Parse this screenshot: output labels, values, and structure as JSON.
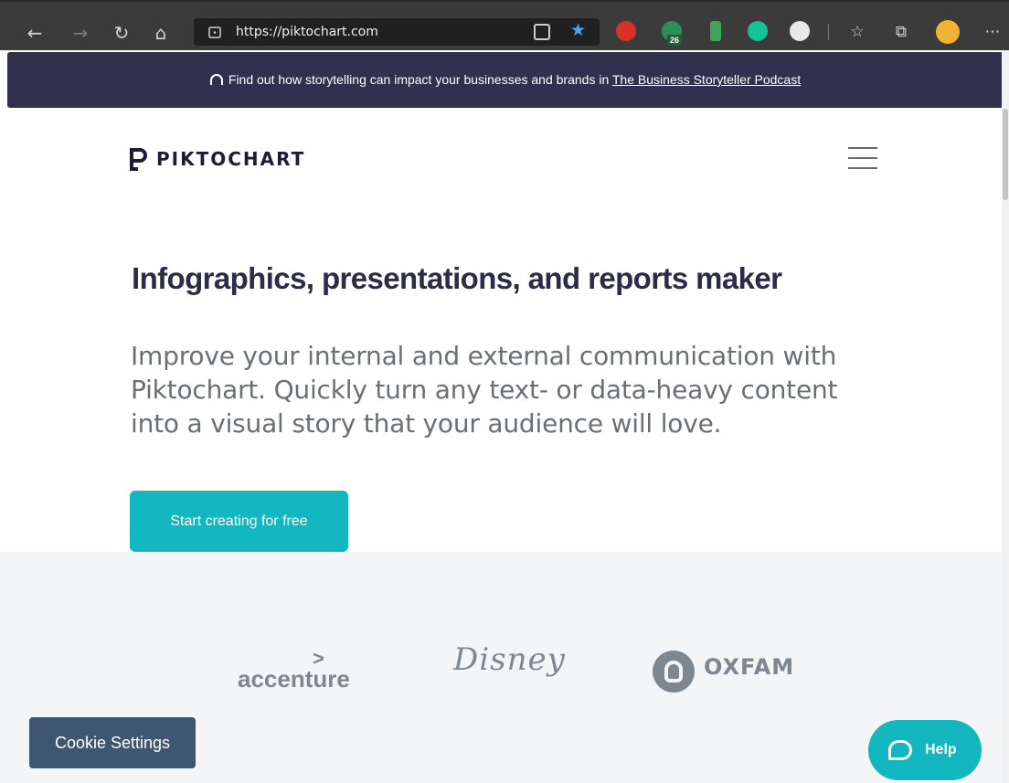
{
  "browser": {
    "url": "https://piktochart.com",
    "extension_badge": "26",
    "colors": {
      "chrome": "#3b3b3b",
      "urlbar": "#202020",
      "star": "#4ea3f5"
    }
  },
  "announcement": {
    "text": "Find out how storytelling can impact your businesses and brands in",
    "link_text": "The Business Storyteller Podcast"
  },
  "header": {
    "logo_text": "PIKTOCHART"
  },
  "hero": {
    "title": "Infographics, presentations, and reports maker",
    "subtitle": "Improve your internal and external communication with Piktochart. Quickly turn any text- or data-heavy content into a visual story that your audience will love.",
    "cta_label": "Start creating for free"
  },
  "logos": {
    "accenture": "accenture",
    "disney": "Disney",
    "oxfam": "OXFAM"
  },
  "floating": {
    "cookie_label": "Cookie Settings",
    "help_label": "Help"
  },
  "colors": {
    "brand_dark": "#32304f",
    "accent": "#12b7bf",
    "cookie": "#3f5671",
    "logo_gray": "#7d8792"
  }
}
